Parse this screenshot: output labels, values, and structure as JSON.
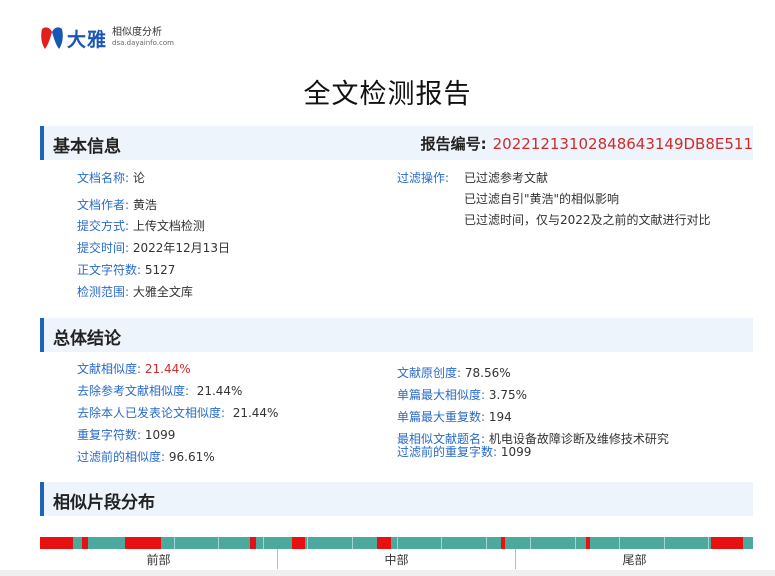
{
  "header": {
    "logo_name": "大雅",
    "logo_subtitle": "相似度分析",
    "logo_url_text": "dsa.dayainfo.com",
    "title": "全文检测报告"
  },
  "basic_info": {
    "section_title": "基本信息",
    "report_no_label": "报告编号:",
    "report_no_value": "20221213102848643149DB8E511",
    "fields": [
      {
        "label": "文档名称:",
        "value": "论"
      },
      {
        "label": "文档作者:",
        "value": "黄浩"
      },
      {
        "label": "提交方式:",
        "value": "上传文档检测"
      },
      {
        "label": "提交时间:",
        "value": "2022年12月13日"
      },
      {
        "label": "正文字符数:",
        "value": "5127"
      },
      {
        "label": "检测范围:",
        "value": "大雅全文库"
      }
    ],
    "filter_label": "过滤操作:",
    "filter_lines": [
      "已过滤参考文献",
      "已过滤自引\"黄浩\"的相似影响",
      "已过滤时间，仅与2022及之前的文献进行对比"
    ]
  },
  "conclusion": {
    "section_title": "总体结论",
    "left": [
      {
        "label": "文献相似度:",
        "value": "21.44%",
        "highlight": true
      },
      {
        "label": "去除参考文献相似度:",
        "value": "21.44%"
      },
      {
        "label": "去除本人已发表论文相似度:",
        "value": "21.44%"
      },
      {
        "label": "重复字符数:",
        "value": "1099"
      },
      {
        "label": "过滤前的相似度:",
        "value": "96.61%"
      }
    ],
    "right": [
      {
        "label": "文献原创度:",
        "value": "78.56%"
      },
      {
        "label": "单篇最大相似度:",
        "value": "3.75%"
      },
      {
        "label": "单篇最大重复数:",
        "value": "194"
      },
      {
        "label": "最相似文献题名:",
        "value": "机电设备故障诊断及维修技术研究"
      },
      {
        "label": "过滤前的重复字数:",
        "value": "1099"
      }
    ]
  },
  "distribution": {
    "section_title": "相似片段分布",
    "colors": {
      "similar": "#e81010",
      "original": "#4ca99d"
    },
    "similar_segments": [
      {
        "start": 0.0,
        "end": 0.046
      },
      {
        "start": 0.059,
        "end": 0.067
      },
      {
        "start": 0.119,
        "end": 0.17
      },
      {
        "start": 0.295,
        "end": 0.304
      },
      {
        "start": 0.354,
        "end": 0.372
      },
      {
        "start": 0.472,
        "end": 0.492
      },
      {
        "start": 0.646,
        "end": 0.652
      },
      {
        "start": 0.766,
        "end": 0.772
      },
      {
        "start": 0.941,
        "end": 0.986
      }
    ],
    "axis_labels": [
      "前部",
      "中部",
      "尾部"
    ]
  }
}
